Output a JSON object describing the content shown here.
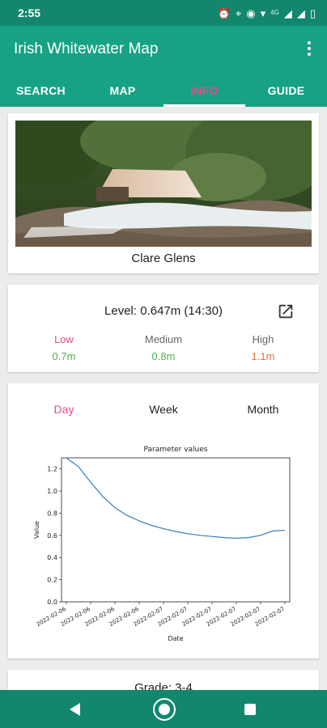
{
  "status_bar": {
    "time": "2:55",
    "network": "4G"
  },
  "app_bar": {
    "title": "Irish Whitewater Map",
    "tabs": [
      {
        "label": "SEARCH",
        "active": false
      },
      {
        "label": "MAP",
        "active": false
      },
      {
        "label": "INFO",
        "active": true
      },
      {
        "label": "GUIDE",
        "active": false
      }
    ]
  },
  "river": {
    "name": "Clare Glens"
  },
  "level": {
    "current": "Level: 0.647m (14:30)",
    "low_label": "Low",
    "low_value": "0.7m",
    "medium_label": "Medium",
    "medium_value": "0.8m",
    "high_label": "High",
    "high_value": "1.1m"
  },
  "range_tabs": {
    "day": "Day",
    "week": "Week",
    "month": "Month",
    "selected": "Day"
  },
  "chart_data": {
    "type": "line",
    "title": "Parameter values",
    "xlabel": "Date",
    "ylabel": "Value",
    "ylim": [
      0.0,
      1.3
    ],
    "yticks": [
      0.0,
      0.2,
      0.4,
      0.6,
      0.8,
      1.0,
      1.2
    ],
    "xtick_labels": [
      "2022-02-06",
      "2022-02-06",
      "2022-02-06",
      "2022-02-06",
      "2022-02-07",
      "2022-02-07",
      "2022-02-07",
      "2022-02-07",
      "2022-02-07",
      "2022-02-07"
    ],
    "grid": false,
    "x": [
      0,
      0.5,
      1,
      1.5,
      2,
      2.5,
      3,
      3.5,
      4,
      4.5,
      5,
      5.5,
      6,
      6.5,
      7,
      7.5,
      8,
      8.5,
      9
    ],
    "values": [
      1.3,
      1.22,
      1.08,
      0.95,
      0.85,
      0.78,
      0.73,
      0.69,
      0.66,
      0.635,
      0.615,
      0.6,
      0.59,
      0.58,
      0.575,
      0.58,
      0.6,
      0.64,
      0.645
    ]
  },
  "grade": {
    "text": "Grade: 3-4"
  },
  "colors": {
    "primary": "#17a285",
    "primary_dark": "#12876d",
    "accent": "#e64a8b",
    "low": "#e64a8b",
    "medium": "#4caf50",
    "high": "#ef6c3c",
    "line": "#2f7fbf"
  }
}
